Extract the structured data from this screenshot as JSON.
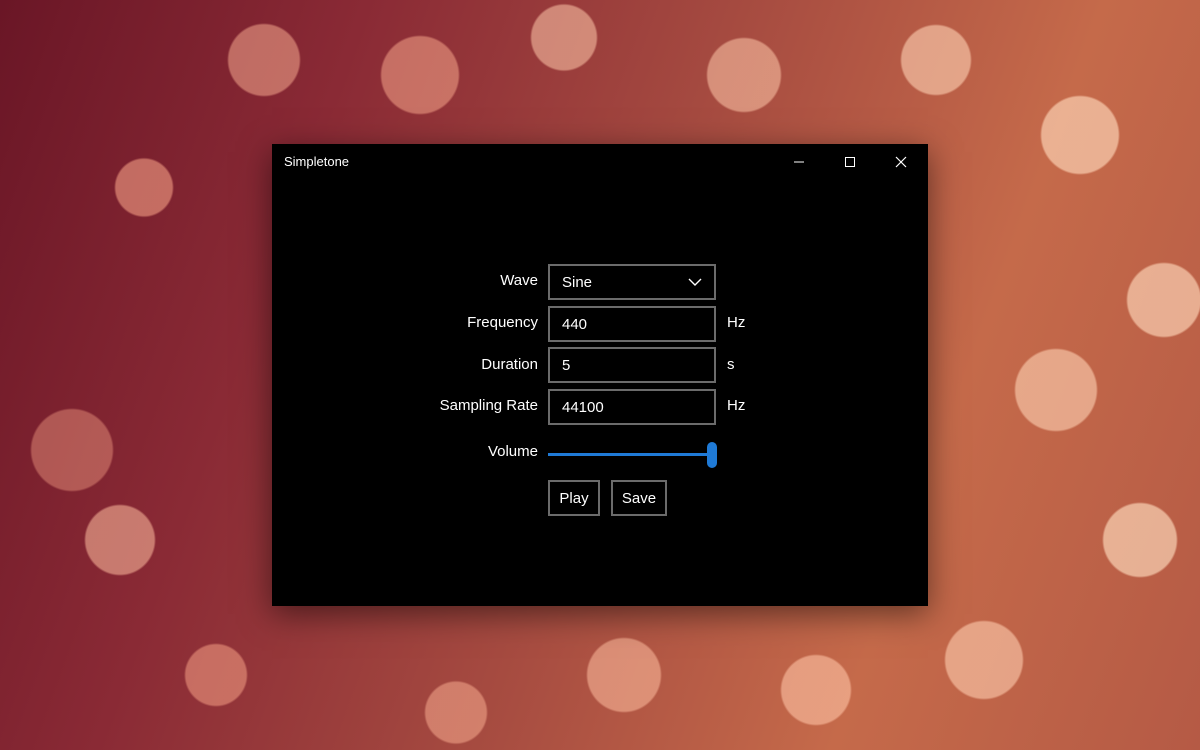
{
  "window": {
    "title": "Simpletone",
    "accent_color": "#1f7ad6"
  },
  "caption": {
    "minimize_icon": "minimize-icon",
    "maximize_icon": "maximize-icon",
    "close_icon": "close-icon"
  },
  "form": {
    "wave": {
      "label": "Wave",
      "value": "Sine"
    },
    "frequency": {
      "label": "Frequency",
      "value": "440",
      "unit": "Hz"
    },
    "duration": {
      "label": "Duration",
      "value": "5",
      "unit": "s"
    },
    "sampling_rate": {
      "label": "Sampling Rate",
      "value": "44100",
      "unit": "Hz"
    },
    "volume": {
      "label": "Volume",
      "level": 1.0
    }
  },
  "actions": {
    "play_label": "Play",
    "save_label": "Save"
  }
}
